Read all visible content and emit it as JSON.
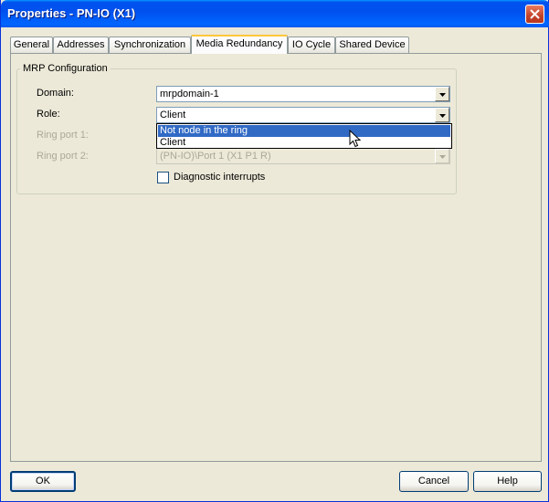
{
  "window": {
    "title": "Properties - PN-IO (X1)"
  },
  "tabs": [
    {
      "label": "General"
    },
    {
      "label": "Addresses"
    },
    {
      "label": "Synchronization"
    },
    {
      "label": "Media Redundancy"
    },
    {
      "label": "IO Cycle"
    },
    {
      "label": "Shared Device"
    }
  ],
  "active_tab": "Media Redundancy",
  "mrp": {
    "group_label": "MRP Configuration",
    "domain": {
      "label": "Domain:",
      "value": "mrpdomain-1"
    },
    "role": {
      "label": "Role:",
      "value": "Client",
      "options": [
        "Not node in the ring",
        "Client"
      ],
      "highlighted": "Not node in the ring"
    },
    "ring_port_1": {
      "label": "Ring port 1:"
    },
    "ring_port_2": {
      "label": "Ring port 2:",
      "value": "(PN-IO)\\Port 1 (X1 P1 R)"
    },
    "diagnostic_interrupts": {
      "label": "Diagnostic interrupts",
      "checked": false
    }
  },
  "buttons": {
    "ok": "OK",
    "cancel": "Cancel",
    "help": "Help"
  },
  "colors": {
    "titlebar": "#0054e3",
    "selection": "#316ac5",
    "face": "#ece9d8"
  }
}
